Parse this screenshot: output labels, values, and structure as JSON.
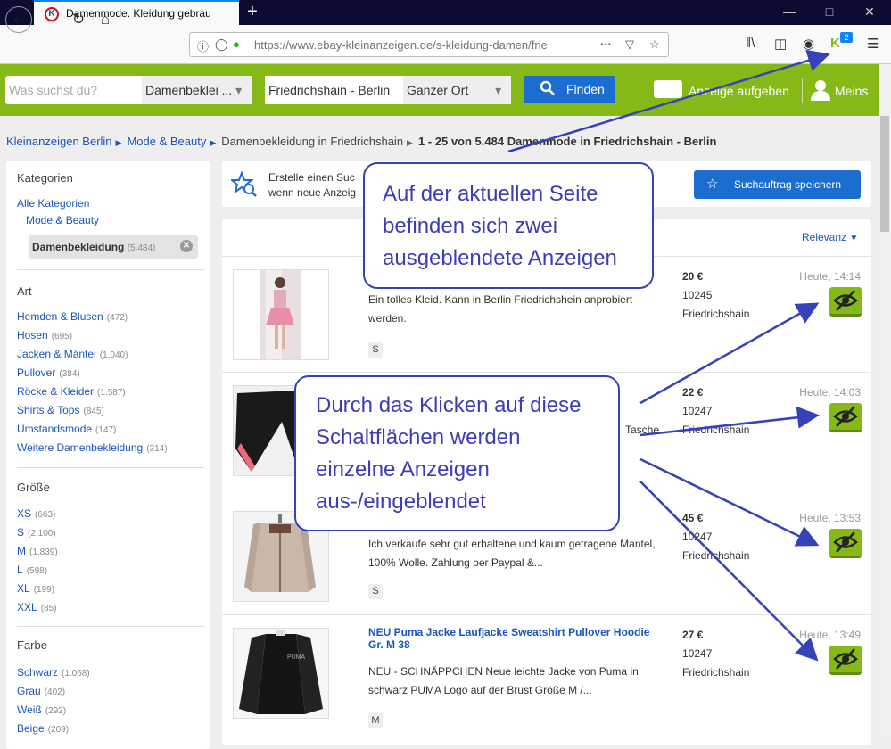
{
  "browser": {
    "tab_title": "Damenmode. Kleidung gebrau",
    "url": "https://www.ebay-kleinanzeigen.de/s-kleidung-damen/frie",
    "ext_badge": "2"
  },
  "header": {
    "search_placeholder": "Was suchst du?",
    "category": "Damenbeklei ...",
    "location": "Friedrichshain - Berlin",
    "radius": "Ganzer Ort",
    "find_label": "Finden",
    "post_label": "Anzeige aufgeben",
    "account_label": "Meins",
    "brand_color": "#86b817",
    "accent_color": "#1c6dd0"
  },
  "breadcrumb": {
    "items": [
      "Kleinanzeigen Berlin",
      "Mode & Beauty"
    ],
    "current": "Damenbekleidung in Friedrichshain",
    "summary": "1 - 25 von 5.484 Damenmode in Friedrichshain - Berlin"
  },
  "sidebar": {
    "categories_title": "Kategorien",
    "all_categories": "Alle Kategorien",
    "parent_category": "Mode & Beauty",
    "selected_category": "Damenbekleidung",
    "selected_count": "(5.484)",
    "art_title": "Art",
    "art_items": [
      {
        "label": "Hemden & Blusen",
        "count": "(472)"
      },
      {
        "label": "Hosen",
        "count": "(695)"
      },
      {
        "label": "Jacken & Mäntel",
        "count": "(1.040)"
      },
      {
        "label": "Pullover",
        "count": "(384)"
      },
      {
        "label": "Röcke & Kleider",
        "count": "(1.587)"
      },
      {
        "label": "Shirts & Tops",
        "count": "(845)"
      },
      {
        "label": "Umstandsmode",
        "count": "(147)"
      },
      {
        "label": "Weitere Damenbekleidung",
        "count": "(314)"
      }
    ],
    "size_title": "Größe",
    "size_items": [
      {
        "label": "XS",
        "count": "(663)"
      },
      {
        "label": "S",
        "count": "(2.100)"
      },
      {
        "label": "M",
        "count": "(1.839)"
      },
      {
        "label": "L",
        "count": "(598)"
      },
      {
        "label": "XL",
        "count": "(199)"
      },
      {
        "label": "XXL",
        "count": "(85)"
      }
    ],
    "color_title": "Farbe",
    "color_items": [
      {
        "label": "Schwarz",
        "count": "(1.068)"
      },
      {
        "label": "Grau",
        "count": "(402)"
      },
      {
        "label": "Weiß",
        "count": "(292)"
      },
      {
        "label": "Beige",
        "count": "(209)"
      }
    ]
  },
  "save_search": {
    "text": "Erstelle einen Suc wenn neue Anzeig",
    "button": "Suchauftrag speichern"
  },
  "sort_label": "Relevanz",
  "listings": [
    {
      "title": "",
      "desc": "Ein tolles Kleid. Kann in Berlin Friedrichshein anprobiert werden.",
      "size": "S",
      "price": "20 €",
      "zip": "10245",
      "city": "Friedrichshain",
      "time": "Heute, 14:14"
    },
    {
      "title": "",
      "desc": "Tasche",
      "size": "",
      "price": "22 €",
      "zip": "10247",
      "city": "Friedrichshain",
      "time": "Heute, 14:03"
    },
    {
      "title": "",
      "desc": "Ich verkaufe sehr gut erhaltene und kaum getragene Mantel, 100% Wolle. Zahlung per Paypal &...",
      "size": "S",
      "price": "45 €",
      "zip": "10247",
      "city": "Friedrichshain",
      "time": "Heute, 13:53"
    },
    {
      "title": "NEU Puma Jacke Laufjacke Sweatshirt Pullover Hoodie Gr. M 38",
      "desc": "NEU - SCHNÄPPCHEN Neue leichte Jacke von Puma in schwarz PUMA Logo auf der Brust Größe M /...",
      "size": "M",
      "price": "27 €",
      "zip": "10247",
      "city": "Friedrichshain",
      "time": "Heute, 13:49"
    }
  ],
  "annotations": {
    "top": "Auf der aktuellen Seite befinden sich zwei ausgeblendete Anzeigen",
    "middle": "Durch das Klicken auf diese Schaltflächen werden einzelne Anzeigen aus-/eingeblendet",
    "color": "#3643b8"
  }
}
